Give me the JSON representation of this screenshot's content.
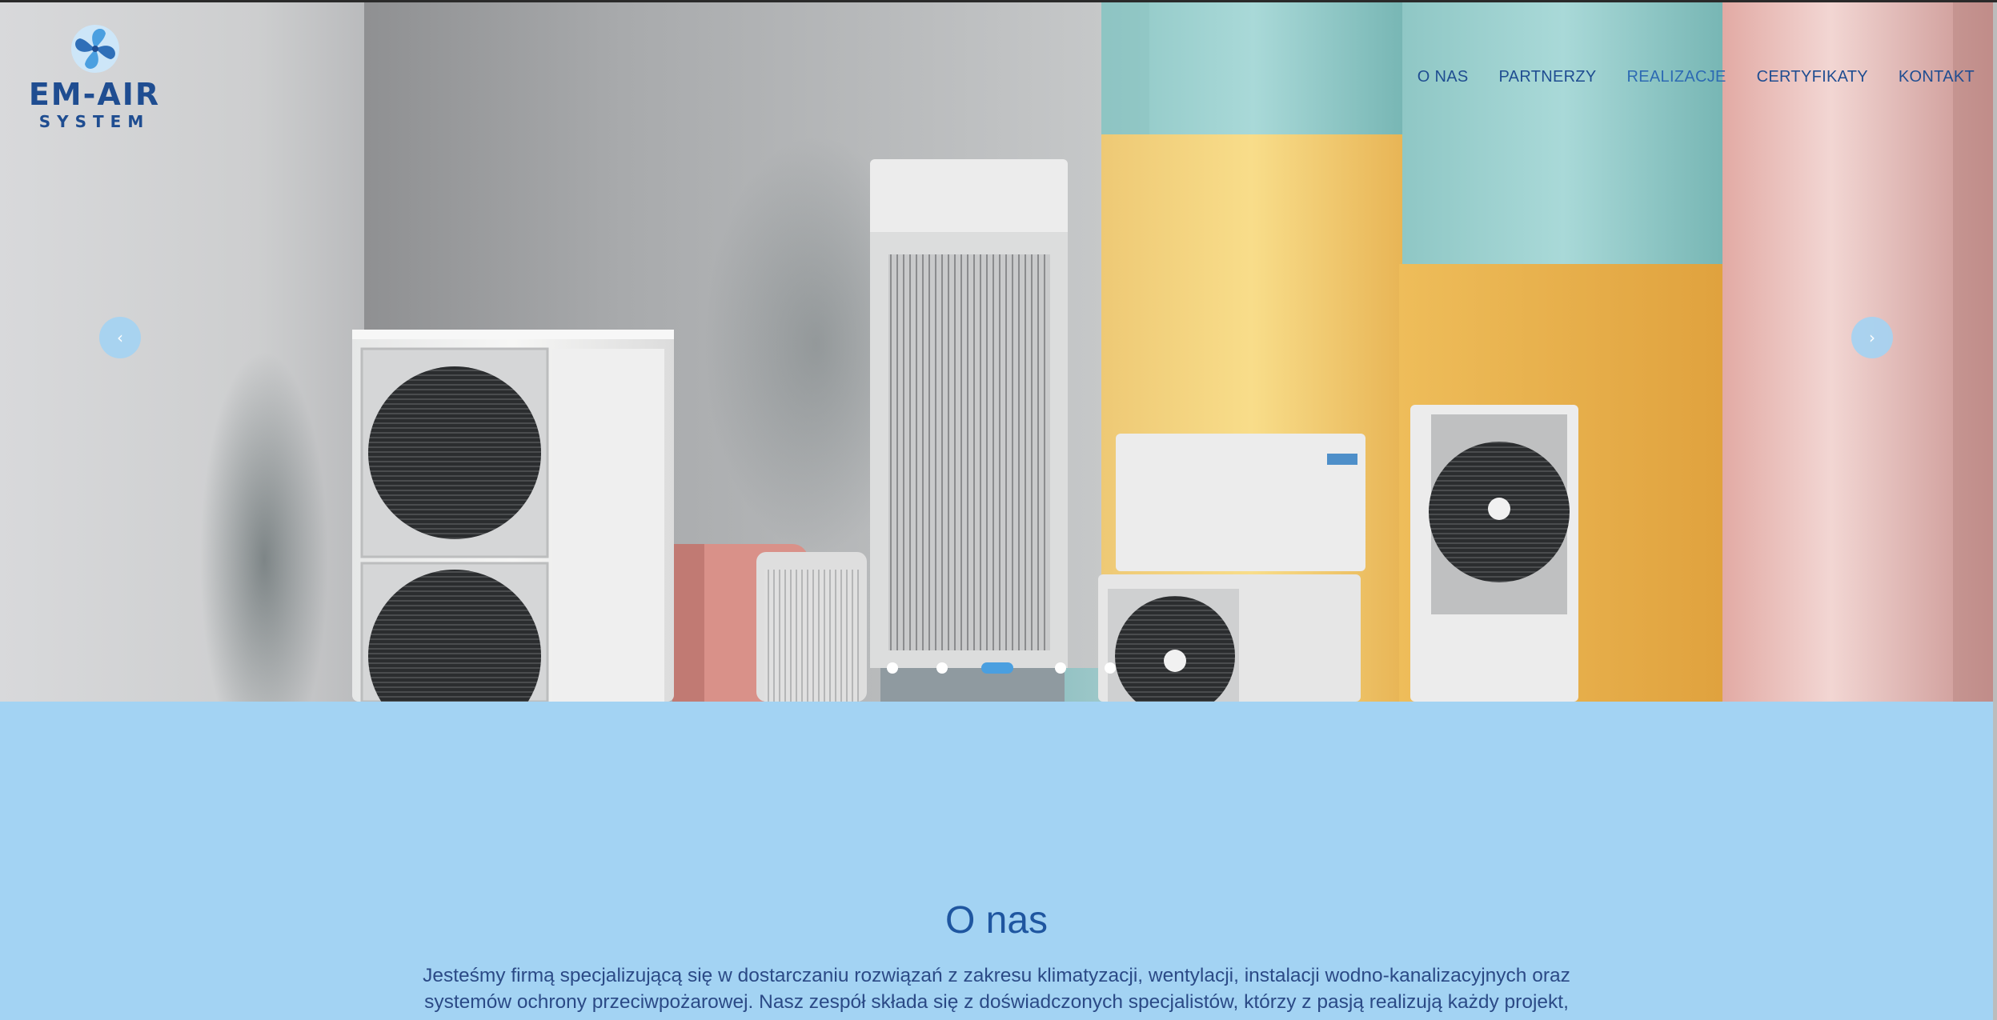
{
  "brand": {
    "logo_name": "EM-AIR",
    "logo_tagline": "SYSTEM",
    "primary_color": "#1f4d91",
    "section_bg": "#a3d3f3"
  },
  "nav": {
    "items": [
      {
        "label": "O NAS"
      },
      {
        "label": "PARTNERZY"
      },
      {
        "label": "REALIZACJE"
      },
      {
        "label": "CERTYFIKATY"
      },
      {
        "label": "KONTAKT"
      }
    ]
  },
  "carousel": {
    "prev_icon": "‹",
    "next_icon": "›",
    "slide_count": 5,
    "active_slide": 3
  },
  "about": {
    "title": "O nas",
    "text_line1": "Jesteśmy firmą specjalizującą się w dostarczaniu rozwiązań z zakresu klimatyzacji, wentylacji, instalacji wodno-kanalizacyjnych oraz",
    "text_line2": "systemów ochrony przeciwpożarowej. Nasz zespół składa się z doświadczonych specjalistów, którzy z pasją realizują każdy projekt,"
  }
}
